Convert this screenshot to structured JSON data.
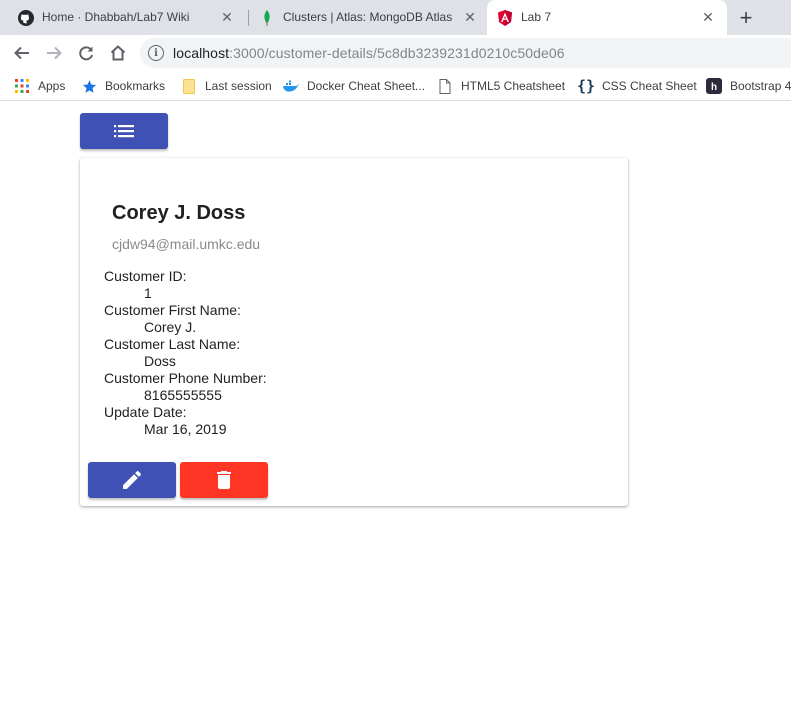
{
  "browser": {
    "tabs": [
      {
        "title": "Home · Dhabbah/Lab7 Wiki",
        "favicon": "github-icon",
        "active": false
      },
      {
        "title": "Clusters | Atlas: MongoDB Atlas",
        "favicon": "mongodb-leaf-icon",
        "active": false
      },
      {
        "title": "Lab 7",
        "favicon": "angular-icon",
        "active": true
      }
    ],
    "new_tab_label": "+",
    "url_host": "localhost",
    "url_rest": ":3000/customer-details/5c8db3239231d0210c50de06",
    "bookmarks": [
      {
        "label": "Apps",
        "icon": "apps-grid-icon"
      },
      {
        "label": "Bookmarks",
        "icon": "star-icon"
      },
      {
        "label": "Last session",
        "icon": "folder-icon"
      },
      {
        "label": "Docker Cheat Sheet...",
        "icon": "docker-icon"
      },
      {
        "label": "HTML5 Cheatsheet",
        "icon": "page-icon"
      },
      {
        "label": "CSS Cheat Sheet",
        "icon": "braces-icon"
      },
      {
        "label": "Bootstrap 4",
        "icon": "hackerrank-icon"
      }
    ]
  },
  "customer": {
    "name": "Corey J. Doss",
    "email": "cjdw94@mail.umkc.edu",
    "fields": [
      {
        "label": "Customer ID:",
        "value": "1"
      },
      {
        "label": "Customer First Name:",
        "value": "Corey J."
      },
      {
        "label": "Customer Last Name:",
        "value": "Doss"
      },
      {
        "label": "Customer Phone Number:",
        "value": "8165555555"
      },
      {
        "label": "Update Date:",
        "value": "Mar 16, 2019"
      }
    ]
  },
  "colors": {
    "primary": "#3f51b5",
    "warn": "#ff3526"
  }
}
